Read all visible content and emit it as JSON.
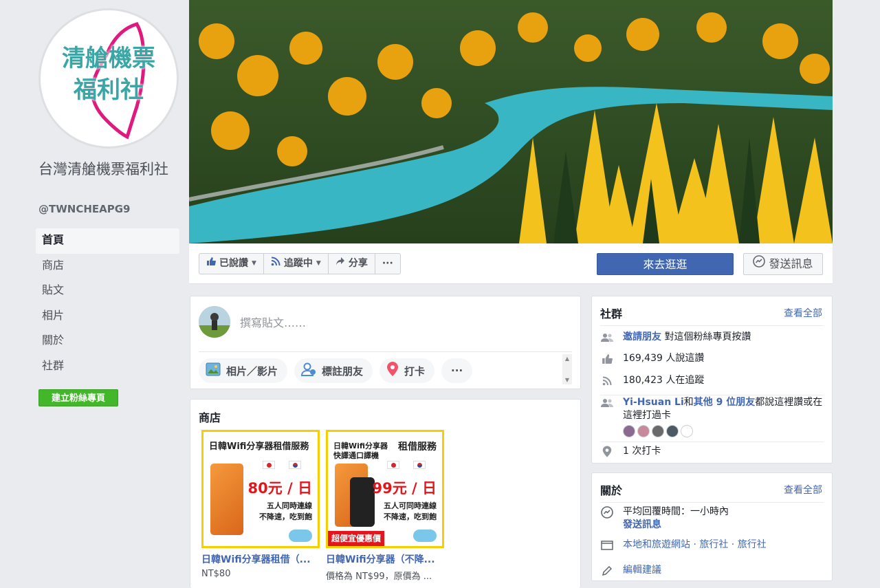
{
  "page": {
    "logo_text": [
      "清艙機票",
      "福利社"
    ],
    "name": "台灣清艙機票福利社",
    "handle": "@TWNCHEAPG9"
  },
  "nav": {
    "items": [
      {
        "label": "首頁",
        "active": true
      },
      {
        "label": "商店"
      },
      {
        "label": "貼文"
      },
      {
        "label": "相片"
      },
      {
        "label": "關於"
      },
      {
        "label": "社群"
      }
    ],
    "create_page_label": "建立粉絲專頁"
  },
  "actions": {
    "liked_label": "已說讚",
    "following_label": "追蹤中",
    "share_label": "分享",
    "more_label": "···",
    "cta_label": "來去逛逛",
    "message_label": "發送訊息"
  },
  "composer": {
    "placeholder": "撰寫貼文……",
    "tools": [
      "相片／影片",
      "標註朋友",
      "打卡",
      "···"
    ]
  },
  "shop": {
    "title": "商店",
    "products": [
      {
        "title": "日韓Wifi分享器租借（...",
        "price": "NT$80",
        "image_text": {
          "head": "日韓Wifi分享器租借服務",
          "price": "80元 / 日",
          "sub": [
            "五人同時連線",
            "不降速，吃到飽"
          ]
        }
      },
      {
        "title": "日韓Wifi分享器（不降...",
        "price": "價格為 NT$99，原價為 ...",
        "image_text": {
          "head": [
            "日韓Wifi分享器",
            "快譯通口譯機"
          ],
          "head2": "租借服務",
          "price": "99元 / 日",
          "sub": [
            "五人可同時連線",
            "不降速，吃到飽"
          ],
          "banner": "超便宜優惠價"
        }
      }
    ]
  },
  "community": {
    "title": "社群",
    "see_all": "查看全部",
    "invite_link": "邀請朋友",
    "invite_text": "對這個粉絲專頁按讚",
    "likes_text": "169,439 人說這讚",
    "follows_text": "180,423 人在追蹤",
    "friends_name": "Yi-Hsuan Li",
    "friends_and": "和",
    "friends_others": "其他 9 位朋友",
    "friends_text": "都說這裡讚或在這裡打過卡",
    "checkins_text": "1 次打卡"
  },
  "about": {
    "title": "關於",
    "see_all": "查看全部",
    "response_time": "平均回覆時間：一小時內",
    "send_message": "發送訊息",
    "categories": "本地和旅遊網站 · 旅行社 · 旅行社",
    "suggest_edits": "編輯建議"
  },
  "colors": {
    "brand_blue": "#4267b2",
    "create_green": "#42b72a",
    "accent_yellow": "#f7cf00",
    "price_red": "#e4161d"
  }
}
